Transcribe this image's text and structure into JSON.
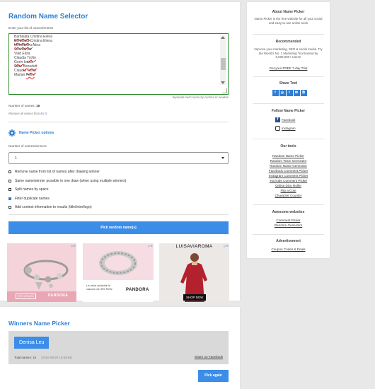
{
  "main": {
    "title": "Random Name Selector",
    "textarea_label": "Enter your list of names/entries",
    "names": [
      "Barbalata Cristina Elena",
      "Barbalata Cristina Elena",
      "Melnebieru Alina",
      "Test adrian",
      "Vlad Eliza",
      "Claudia Trofin",
      "Gorin Ioana",
      "Tatar Benedett",
      "Claudia Trofin",
      "Marian Petru"
    ],
    "separator_hint": "Separate each name by comma or newline",
    "count_label": "Number of names:",
    "count_value": "15",
    "remove_all": "Remove all names from list",
    "remove_all_x": "X",
    "options_title": "Name Picker options",
    "winners_label": "Number of names/winners",
    "winners_value": "1",
    "options": [
      {
        "label": "Remove name from list of names after drawing winner",
        "checked": false
      },
      {
        "label": "Same name/winner possible in one draw (when using multiple winners)",
        "checked": false
      },
      {
        "label": "Split names by space",
        "checked": false
      },
      {
        "label": "Filter duplicate names",
        "checked": true
      },
      {
        "label": "Add contest information to results (title/intro/logo)",
        "checked": false
      }
    ],
    "pick_button": "Pick random name(s)"
  },
  "ads": [
    {
      "brand": "PANDORA",
      "sub": "EXPLOREAZĂ"
    },
    {
      "brand": "PANDORA",
      "text": "La orice achiziție în valoare de 399 RON"
    },
    {
      "brand": "LUISAVIAROMA",
      "cta": "SHOP NOW"
    }
  ],
  "winners": {
    "title": "Winners Name Picker",
    "winner_name": "Denisa Leu",
    "total_label": "Total names:",
    "total_value": "15",
    "timestamp": "(2020-09-28 16:59:54)",
    "share": "Share on Facebook",
    "pick_again": "Pick again"
  },
  "sidebar": {
    "about_title": "About Name Picker",
    "about_text": "Name Picker is the free website for all your social and easy-to-use online tools",
    "recommended_title": "Recommended",
    "recommended_text": "Improve your marketing, SEO & social media. Try the World's No. 1 Marketing Tool trusted by 5,000,000+ Users!",
    "trial_link": "Get your FREE 7-day Trial",
    "share_title": "Share Tool",
    "follow_title": "Follow Name Picker",
    "facebook": "Facebook",
    "instagram": "Instagram",
    "tools_title": "Our tools",
    "tools": [
      "Random Name Picker",
      "Random Team Generator",
      "Random Name Generator",
      "Facebook Comment Picker",
      "Instagram Comment Picker",
      "YouTube Comment Picker",
      "Online Dice Roller",
      "Flip a Coin",
      "Character Counter"
    ],
    "websites_title": "Awesome websites",
    "websites": [
      "Comment Picker",
      "Random Generator"
    ],
    "ad_title": "Advertisement",
    "ad_link": "Coupon Codes & Deals"
  }
}
